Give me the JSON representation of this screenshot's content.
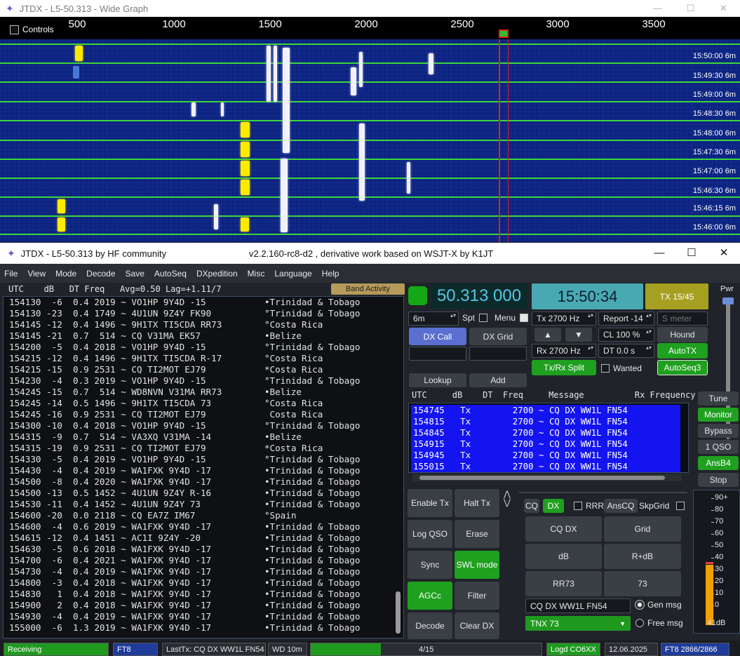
{
  "wide_graph": {
    "title": "JTDX - L5-50.313 - Wide Graph",
    "controls_label": "Controls",
    "scale_ticks": [
      "500",
      "1000",
      "1500",
      "2000",
      "2500",
      "3000",
      "3500"
    ],
    "time_labels": [
      "15:50:00  6m",
      "15:49:30  6m",
      "15:49:00  6m",
      "15:48:30  6m",
      "15:48:00  6m",
      "15:47:30  6m",
      "15:47:00  6m",
      "15:46:30  6m",
      "15:46:15  6m",
      "15:46:00  6m"
    ],
    "colors": {
      "separator": "#3cd63c",
      "rx_marker": "#e02020",
      "signal": "#ffea00"
    }
  },
  "main": {
    "title": "JTDX - L5-50.313  by HF community",
    "subtitle": "v2.2.160-rc8-d2 , derivative work based on WSJT-X by K1JT",
    "menu": [
      "File",
      "View",
      "Mode",
      "Decode",
      "Save",
      "AutoSeq",
      "DXpedition",
      "Misc",
      "Language",
      "Help"
    ],
    "band_activity": {
      "header": "UTC    dB   DT Freq   Avg=0.50 Lag=+1.11/7",
      "button": "Band Activity",
      "rows": [
        "154130  -6  0.4 2019 ~ VO1HP 9Y4D -15           •Trinidad & Tobago",
        "154130 -23  0.4 1749 ~ 4U1UN 9Z4Y FK90          °Trinidad & Tobago",
        "154145 -12  0.4 1496 ~ 9H1TX TI5CDA RR73        °Costa Rica",
        "154145 -21  0.7  514 ~ CQ V31MA EK57            •Belize",
        "154200  -5  0.4 2018 ~ VO1HP 9Y4D -15           °Trinidad & Tobago",
        "154215 -12  0.4 1496 ~ 9H1TX TI5CDA R-17        °Costa Rica",
        "154215 -15  0.9 2531 ~ CQ TI2MOT EJ79           *Costa Rica",
        "154230  -4  0.3 2019 ~ VO1HP 9Y4D -15           °Trinidad & Tobago",
        "154245 -15  0.7  514 ~ WD8NVN V31MA RR73        •Belize",
        "154245 -14  0.5 1496 ~ 9H1TX TI5CDA 73          °Costa Rica",
        "154245 -16  0.9 2531 ~ CQ TI2MOT EJ79            Costa Rica",
        "154300 -10  0.4 2018 ~ VO1HP 9Y4D -15           °Trinidad & Tobago",
        "154315  -9  0.7  514 ~ VA3XQ V31MA -14          •Belize",
        "154315 -19  0.9 2531 ~ CQ TI2MOT EJ79           *Costa Rica",
        "154330  -5  0.4 2019 ~ VO1HP 9Y4D -15           °Trinidad & Tobago",
        "154430  -4  0.4 2019 ~ WA1FXK 9Y4D -17          •Trinidad & Tobago",
        "154500  -8  0.4 2020 ~ WA1FXK 9Y4D -17          •Trinidad & Tobago",
        "154500 -13  0.5 1452 ~ 4U1UN 9Z4Y R-16          •Trinidad & Tobago",
        "154530 -11  0.4 1452 ~ 4U1UN 9Z4Y 73            •Trinidad & Tobago",
        "154600 -20  0.0 2118 ~ CQ EA7Z IM67             °Spain",
        "154600  -4  0.6 2019 ~ WA1FXK 9Y4D -17          •Trinidad & Tobago",
        "154615 -12  0.4 1451 ~ AC1I 9Z4Y -20            •Trinidad & Tobago",
        "154630  -5  0.6 2018 ~ WA1FXK 9Y4D -17          •Trinidad & Tobago",
        "154700  -6  0.4 2021 ~ WA1FXK 9Y4D -17          •Trinidad & Tobago",
        "154730  -4  0.4 2019 ~ WA1FXK 9Y4D -17          •Trinidad & Tobago",
        "154800  -3  0.4 2018 ~ WA1FXK 9Y4D -17          •Trinidad & Tobago",
        "154830   1  0.4 2018 ~ WA1FXK 9Y4D -17          •Trinidad & Tobago",
        "154900   2  0.4 2018 ~ WA1FXK 9Y4D -17          •Trinidad & Tobago",
        "154930  -4  0.4 2019 ~ WA1FXK 9Y4D -17          •Trinidad & Tobago",
        "155000  -6  1.3 2019 ~ WA1FXK 9Y4D -17          •Trinidad & Tobago"
      ]
    },
    "top": {
      "freq": "50.313 000",
      "clock": "15:50:34",
      "tx_slot": "TX 15/45",
      "pwr_label": "Pwr",
      "band": "6m",
      "spt": "Spt",
      "menu": "Menu",
      "tx_hz": "Tx  2700  Hz",
      "rx_hz": "Rx  2700  Hz",
      "report": "Report  -14",
      "s_meter": "S meter",
      "cl": "CL  100 %",
      "dt": "DT  0.0 s",
      "hound": "Hound",
      "autotx": "AutoTX",
      "autoseq3": "AutoSeq3",
      "wanted": "Wanted",
      "txrx_split": "Tx/Rx Split",
      "dx_call": "DX Call",
      "dx_grid": "DX Grid",
      "lookup": "Lookup",
      "add": "Add"
    },
    "tx_window": {
      "header": "UTC     dB    DT  Freq     Message          Rx Frequency",
      "rows": [
        "154745   Tx        2700 ~ CQ DX WW1L FN54",
        "154815   Tx        2700 ~ CQ DX WW1L FN54",
        "154845   Tx        2700 ~ CQ DX WW1L FN54",
        "154915   Tx        2700 ~ CQ DX WW1L FN54",
        "154945   Tx        2700 ~ CQ DX WW1L FN54",
        "155015   Tx        2700 ~ CQ DX WW1L FN54"
      ]
    },
    "side_buttons": [
      "Tune",
      "Monitor",
      "Bypass",
      "1 QSO",
      "AnsB4",
      "Stop"
    ],
    "left_buttons": [
      "Enable Tx",
      "Halt Tx",
      "Log QSO",
      "Erase",
      "Sync",
      "SWL mode",
      "AGCc",
      "Filter",
      "Decode",
      "Clear DX"
    ],
    "msg_panel": {
      "cq": "CQ",
      "dx": "DX",
      "rrr": "RRR",
      "anscq": "AnsCQ",
      "skpgrid": "SkpGrid",
      "buttons": [
        "CQ DX",
        "Grid",
        "dB",
        "R+dB",
        "RR73",
        "73"
      ],
      "gen_field": "CQ DX WW1L FN54",
      "gen_msg": "Gen msg",
      "free_field": "TNX 73",
      "free_msg": "Free msg"
    },
    "gauge": {
      "ticks": [
        "90+",
        "80",
        "70",
        "60",
        "50",
        "40",
        "30",
        "20",
        "10",
        "0"
      ],
      "value": "41dB",
      "level_db": 41
    },
    "status": {
      "receiving": "Receiving",
      "mode": "FT8",
      "last_tx": "LastTx: CQ DX WW1L FN54",
      "wd": "WD 10m",
      "progress": "4/15",
      "logd": "Logd CO6XX",
      "date": "12.06.2025",
      "ft8_count": "FT8  2866/2866"
    }
  }
}
